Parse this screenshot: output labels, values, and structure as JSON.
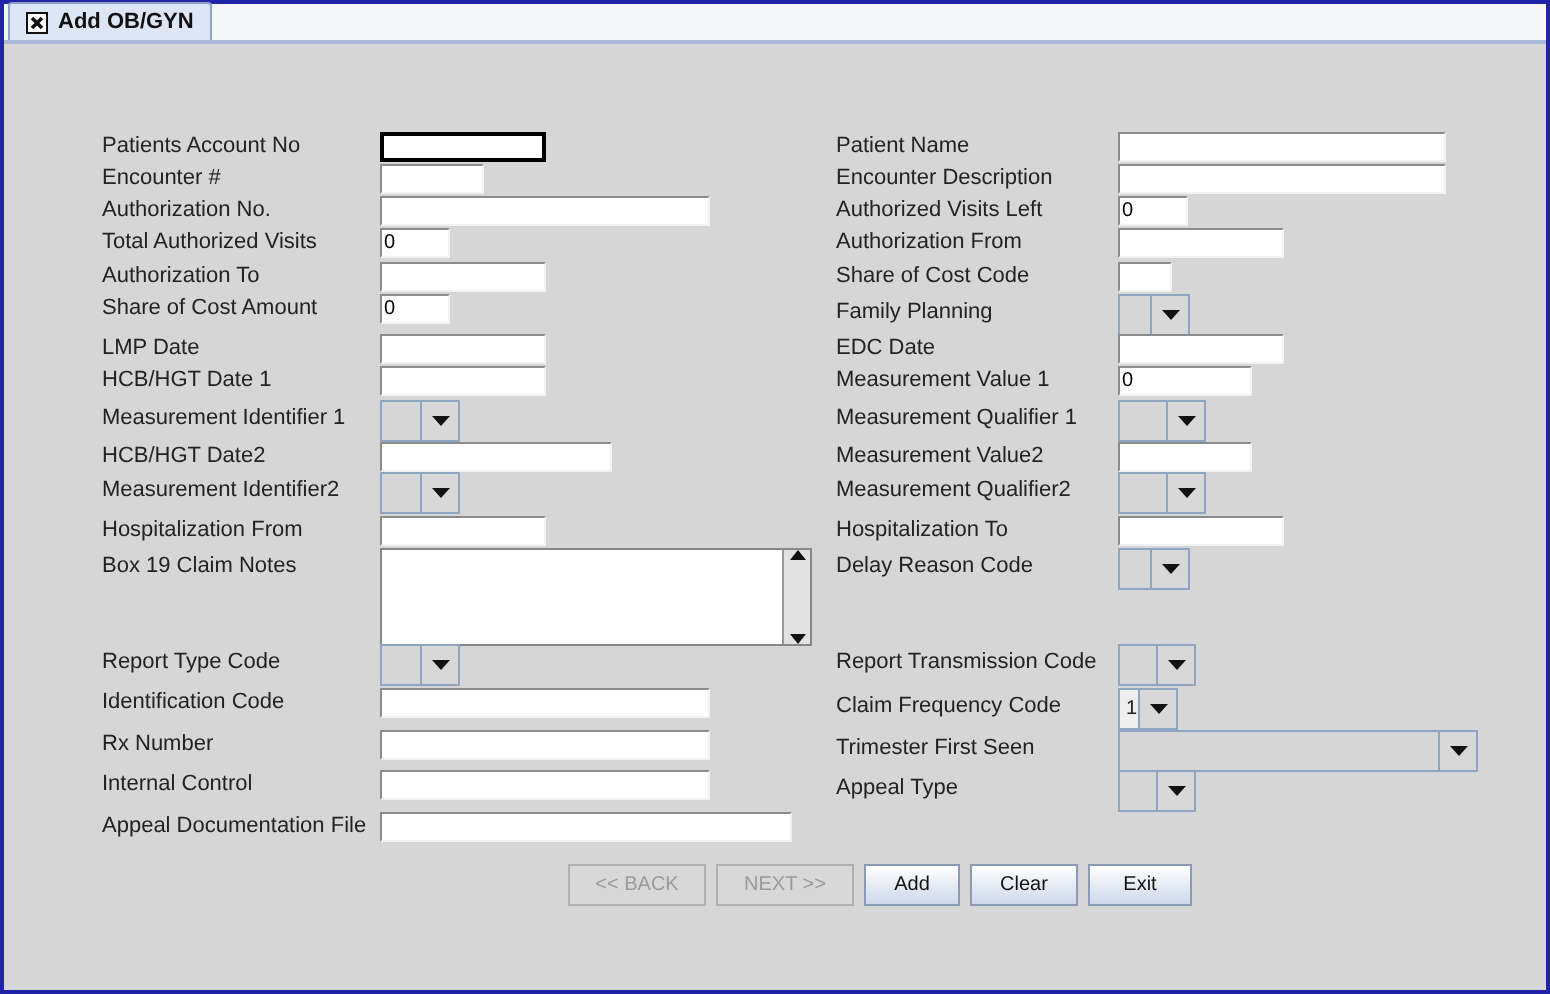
{
  "tab": {
    "title": "Add OB/GYN",
    "selected": true
  },
  "rows": [
    {
      "left": {
        "label": "Patients Account No",
        "kind": "text",
        "focused": true
      },
      "right": {
        "label": "Patient Name",
        "kind": "text",
        "focused": false
      }
    },
    {
      "left": {
        "label": "Encounter #",
        "kind": "text",
        "focused": false
      },
      "right": {
        "label": "Encounter Description",
        "kind": "text",
        "focused": false
      }
    },
    {
      "left": {
        "label": "Authorization No.",
        "kind": "text",
        "focused": false
      },
      "right": {
        "label": "Authorized Visits Left",
        "kind": "text",
        "value": "0",
        "focused": false
      }
    },
    {
      "left": {
        "label": "Total Authorized Visits",
        "kind": "text",
        "value": "0",
        "focused": false
      },
      "right": {
        "label": "Authorization From",
        "kind": "text",
        "focused": false
      }
    },
    {
      "left": {
        "label": "Authorization To",
        "kind": "text",
        "focused": false
      },
      "right": {
        "label": "Share of Cost Code",
        "kind": "text",
        "focused": false
      }
    },
    {
      "left": {
        "label": "Share of Cost Amount",
        "kind": "text",
        "value": "0",
        "focused": false
      },
      "right": {
        "label": "Family Planning",
        "kind": "combo"
      }
    },
    {
      "left": {
        "label": "LMP Date",
        "kind": "text",
        "focused": false
      },
      "right": {
        "label": "EDC Date",
        "kind": "text",
        "focused": false
      }
    },
    {
      "left": {
        "label": "HCB/HGT Date 1",
        "kind": "text",
        "focused": false
      },
      "right": {
        "label": "Measurement Value 1",
        "kind": "text",
        "value": "0",
        "focused": false
      }
    },
    {
      "left": {
        "label": "Measurement Identifier 1",
        "kind": "combo"
      },
      "right": {
        "label": "Measurement Qualifier 1",
        "kind": "combo"
      }
    },
    {
      "left": {
        "label": "HCB/HGT Date2",
        "kind": "text",
        "focused": false
      },
      "right": {
        "label": "Measurement Value2",
        "kind": "text",
        "focused": false
      }
    },
    {
      "left": {
        "label": "Measurement Identifier2",
        "kind": "combo"
      },
      "right": {
        "label": "Measurement Qualifier2",
        "kind": "combo"
      }
    },
    {
      "left": {
        "label": "Hospitalization From",
        "kind": "text",
        "focused": false
      },
      "right": {
        "label": "Hospitalization To",
        "kind": "text",
        "focused": false
      }
    },
    {
      "left": {
        "label": "Box 19 Claim Notes",
        "kind": "textarea"
      },
      "right": {
        "label": "Delay Reason Code",
        "kind": "combo"
      }
    },
    {
      "left": {
        "label": "Report Type Code",
        "kind": "combo"
      },
      "right": {
        "label": "Report Transmission Code",
        "kind": "combo"
      }
    },
    {
      "left": {
        "label": "Identification Code",
        "kind": "text",
        "focused": false
      },
      "right": {
        "label": "Claim Frequency Code",
        "kind": "combo",
        "value": "1"
      }
    },
    {
      "left": {
        "label": "Rx Number",
        "kind": "text",
        "focused": false
      },
      "right": {
        "label": "Trimester First Seen",
        "kind": "combo"
      }
    },
    {
      "left": {
        "label": "Internal Control",
        "kind": "text",
        "focused": false
      },
      "right": {
        "label": "Appeal Type",
        "kind": "combo"
      }
    },
    {
      "left": {
        "label": "Appeal Documentation File",
        "kind": "text",
        "focused": false
      }
    }
  ],
  "buttons": [
    {
      "label": "<< BACK",
      "disabled": true
    },
    {
      "label": "NEXT >>",
      "disabled": true
    },
    {
      "label": "Add",
      "disabled": false
    },
    {
      "label": "Clear",
      "disabled": false
    },
    {
      "label": "Exit",
      "disabled": false
    }
  ]
}
